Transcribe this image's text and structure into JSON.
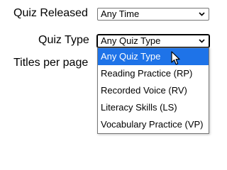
{
  "filters": {
    "quiz_released": {
      "label": "Quiz Released",
      "value": "Any Time"
    },
    "quiz_type": {
      "label": "Quiz Type",
      "value": "Any Quiz Type",
      "options": [
        "Any Quiz Type",
        "Reading Practice (RP)",
        "Recorded Voice (RV)",
        "Literacy Skills (LS)",
        "Vocabulary Practice (VP)"
      ],
      "highlighted_option": "Any Quiz Type"
    },
    "titles_per_page": {
      "label": "Titles per page"
    }
  },
  "colors": {
    "highlight": "#1e73e8"
  },
  "icons": {
    "dropdown": "chevron-down-icon",
    "pointer": "mouse-cursor-icon"
  }
}
